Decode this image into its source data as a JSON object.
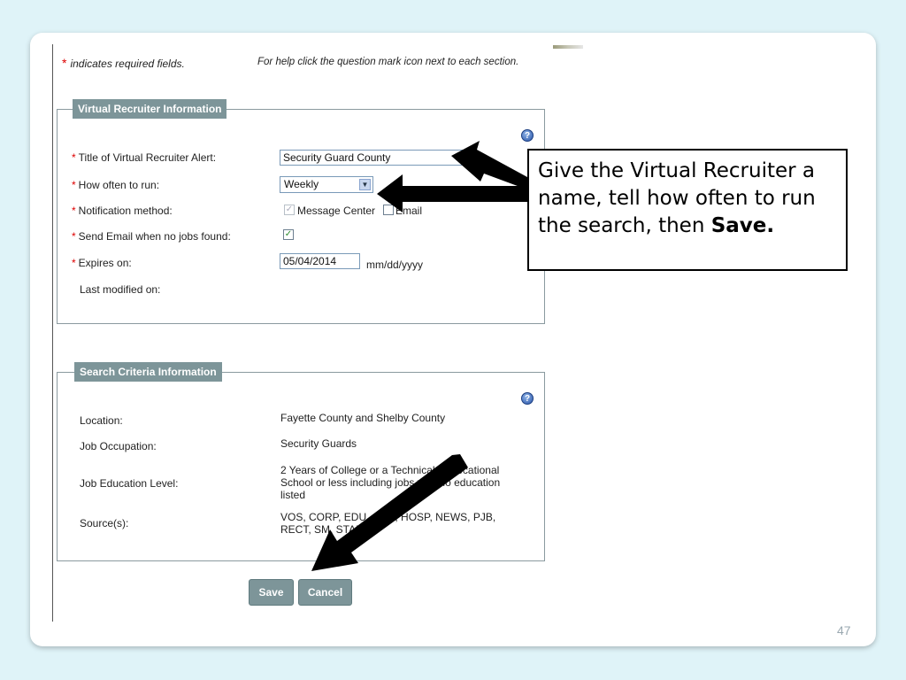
{
  "header": {
    "required_star": "*",
    "required_note": "indicates required fields.",
    "help_note": "For help click the question mark icon next to each section."
  },
  "vr_section": {
    "legend": "Virtual Recruiter Information",
    "title_label": "Title of Virtual Recruiter Alert:",
    "title_value": "Security Guard County",
    "frequency_label": "How often to run:",
    "frequency_value": "Weekly",
    "notification_label": "Notification method:",
    "notification_option_1": "Message Center",
    "notification_option_2": "Email",
    "no_jobs_email_label": "Send Email when no jobs found:",
    "expires_label": "Expires on:",
    "expires_value": "05/04/2014",
    "expires_format": "mm/dd/yyyy",
    "last_modified_label": "Last modified on:"
  },
  "criteria_section": {
    "legend": "Search Criteria Information",
    "location_label": "Location:",
    "location_value": "Fayette County and Shelby County",
    "occupation_label": "Job Occupation:",
    "occupation_value": "Security Guards",
    "education_label": "Job Education Level:",
    "education_value": "2 Years of College or a Technical or Vocational School or less including jobs with no education listed",
    "sources_label": "Source(s):",
    "sources_value": "VOS, CORP, EDU, GOV, HOSP, NEWS, PJB, RECT, SM, STAFF"
  },
  "buttons": {
    "save": "Save",
    "cancel": "Cancel"
  },
  "callout": {
    "text": "Give the Virtual Recruiter a name, tell how often to run the search, then ",
    "bold": "Save."
  },
  "slide_number": "47",
  "icons": {
    "help": "question-mark-icon",
    "check": "checkmark-icon",
    "dropdown": "chevron-down-icon"
  },
  "colors": {
    "legend_bg": "#7d9599",
    "required": "#dd0000",
    "background": "#dff3f8"
  }
}
